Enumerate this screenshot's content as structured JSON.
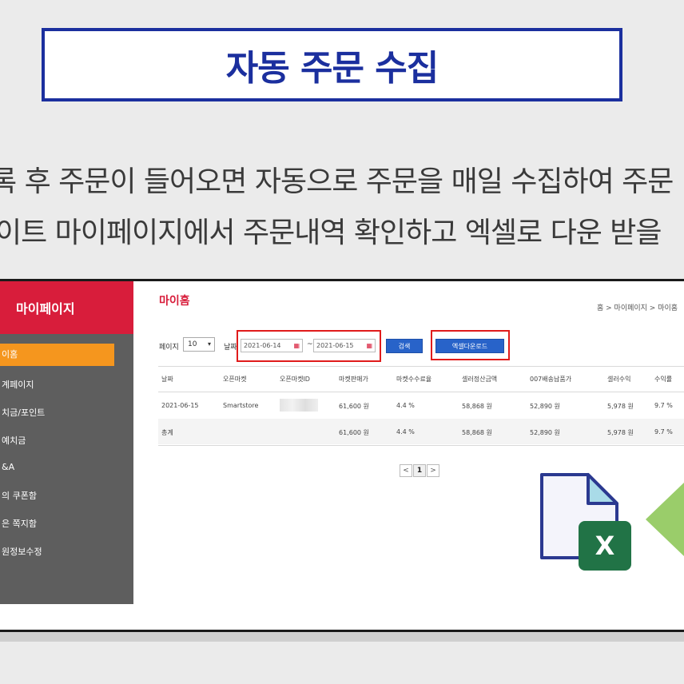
{
  "title": "자동 주문 수집",
  "description": {
    "line1": "록 후 주문이 들어오면 자동으로 주문을 매일 수집하여 주문",
    "line2": "이트 마이페이지에서 주문내역 확인하고 엑셀로 다운 받을"
  },
  "sidebar": {
    "header": "마이페이지",
    "items": [
      {
        "label": "이홈",
        "active": true
      },
      {
        "label": "계페이지"
      },
      {
        "label": "치금/포인트"
      },
      {
        "label": "예치금"
      },
      {
        "label": "&A"
      },
      {
        "label": "의 쿠폰함"
      },
      {
        "label": "은 쪽지함"
      },
      {
        "label": "원정보수정"
      }
    ]
  },
  "main": {
    "title": "마이홈",
    "breadcrumb": "홈 > 마이페이지 > 마이홈",
    "filters": {
      "page_label": "페이지",
      "page_size": "10",
      "date_label": "날짜",
      "date_from": "2021-06-14",
      "date_to": "2021-06-15",
      "separator": "~",
      "search_button": "검색",
      "excel_button": "엑셀다운로드"
    },
    "table": {
      "columns": [
        "날짜",
        "오픈마켓",
        "오픈마켓ID",
        "마켓판매가",
        "마켓수수료율",
        "셀러정산금액",
        "007배송납품가",
        "셀러수익",
        "수익률"
      ],
      "rows": [
        [
          "2021-06-15",
          "Smartstore",
          "",
          "61,600 원",
          "4.4 %",
          "58,868 원",
          "52,890 원",
          "5,978 원",
          "9.7 %"
        ]
      ],
      "total": [
        "총계",
        "",
        "",
        "61,600 원",
        "4.4 %",
        "58,868 원",
        "52,890 원",
        "5,978 원",
        "9.7 %"
      ]
    },
    "pagination": {
      "prev": "<",
      "current": "1",
      "next": ">"
    }
  },
  "excel_icon": {
    "letter": "X",
    "color": "#217346"
  },
  "colors": {
    "title_blue": "#1b2f9e",
    "brand_red": "#d81d3b",
    "active_orange": "#f5961e",
    "arrow_green": "#9acd6a"
  }
}
